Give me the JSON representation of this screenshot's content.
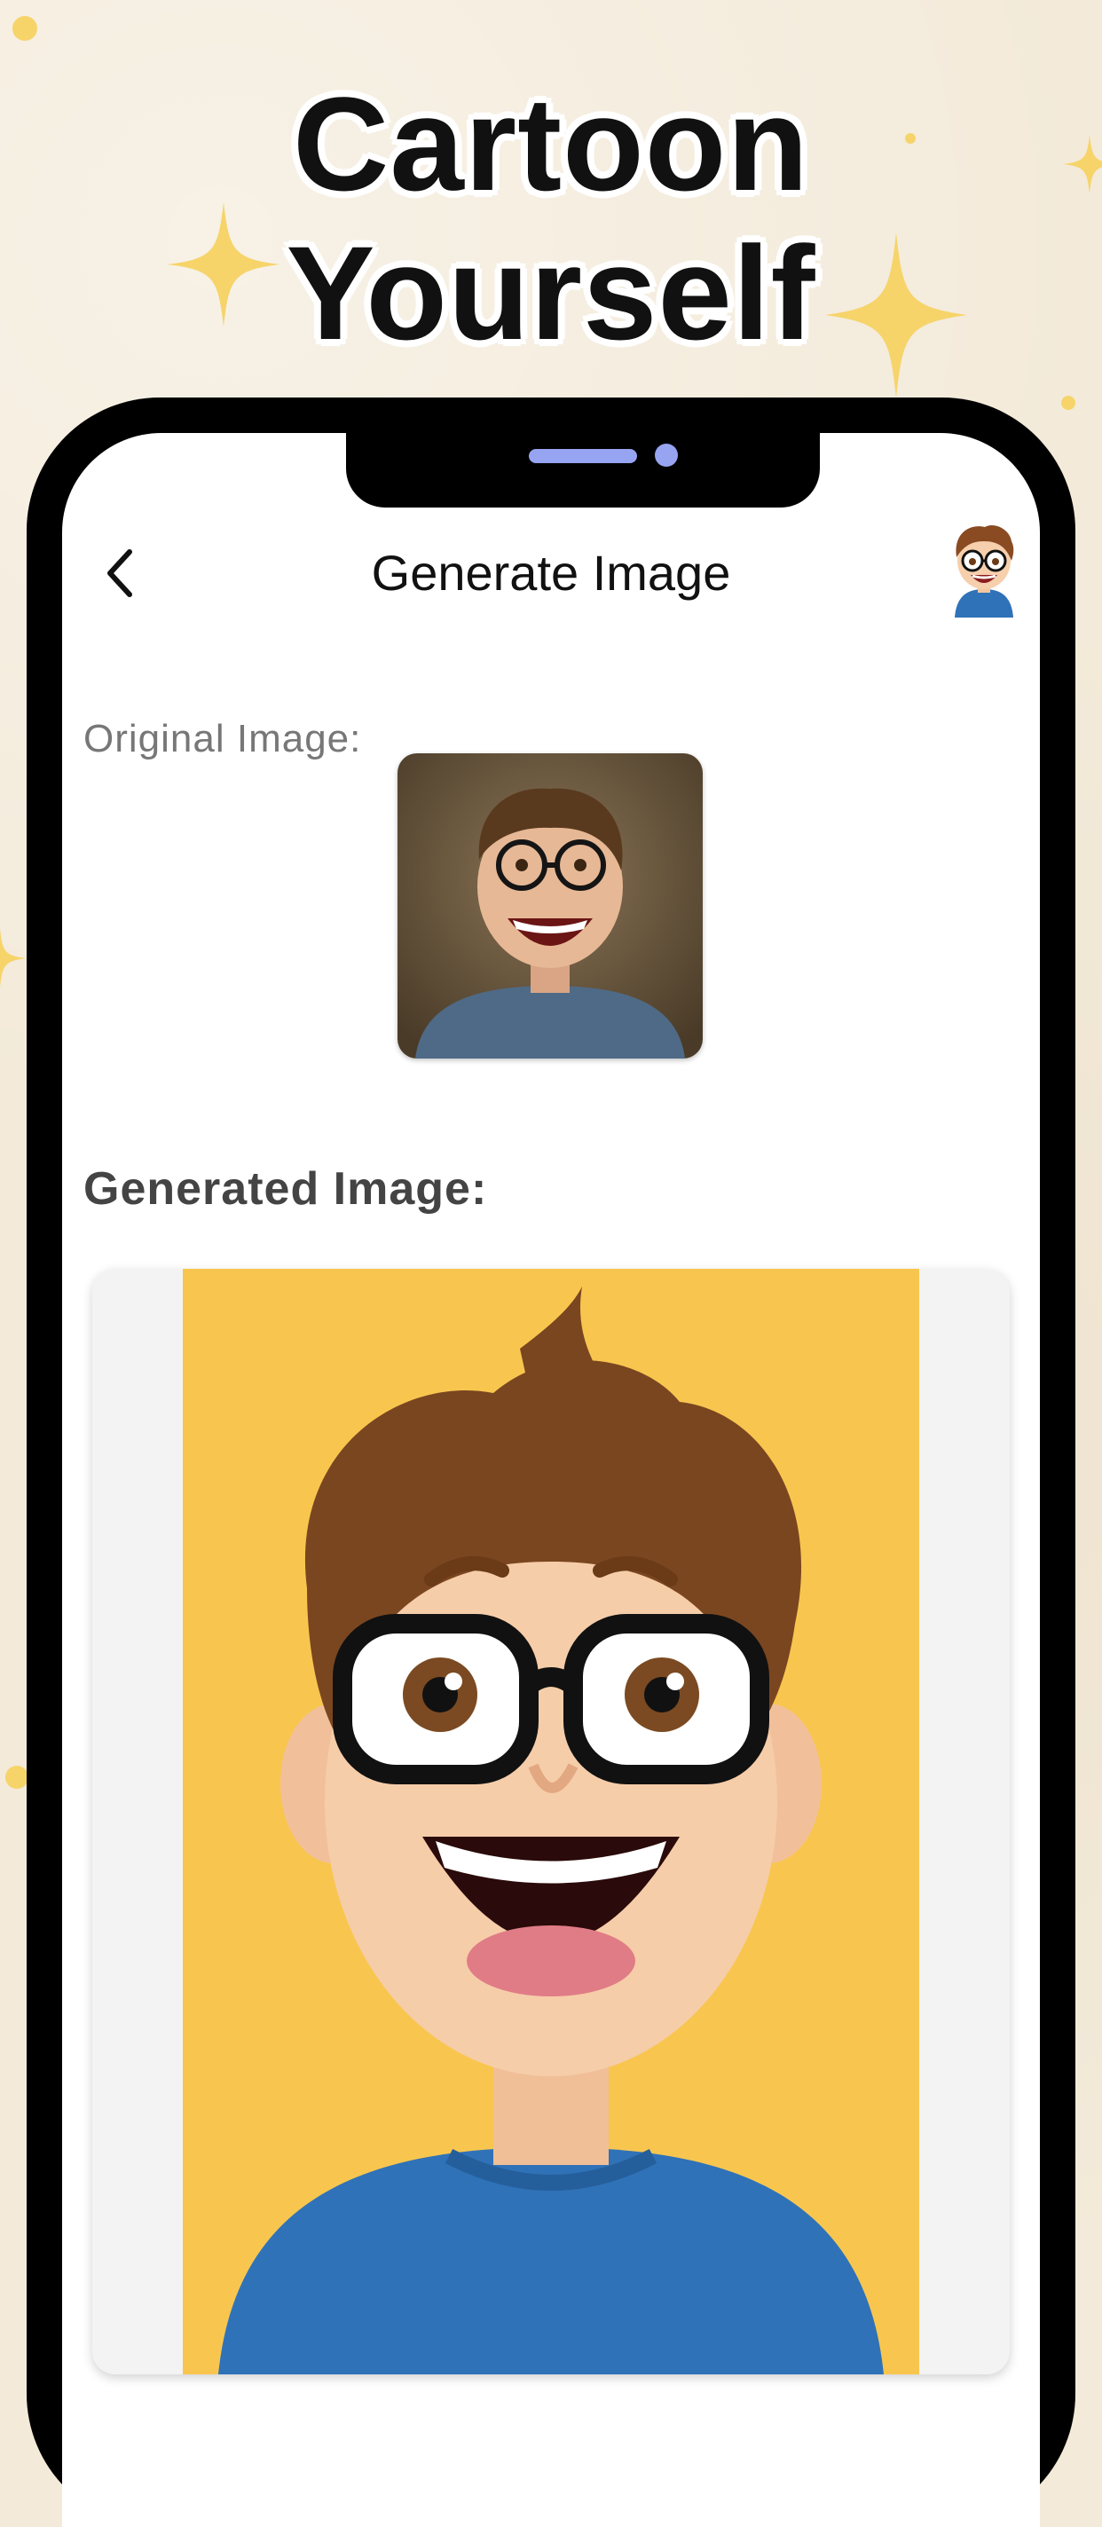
{
  "headline": {
    "line1": "Cartoon",
    "line2": "Yourself"
  },
  "nav": {
    "title": "Generate Image",
    "back_icon": "chevron-left-icon",
    "avatar_icon": "cartoon-avatar-icon"
  },
  "original": {
    "label": "Original Image:"
  },
  "generated": {
    "label": "Generated Image:"
  },
  "colors": {
    "background": "#f3ead9",
    "sparkle": "#f6d46a",
    "notch_accent": "#97a4f2",
    "generated_bg": "#f8c64f",
    "shirt": "#2f72b8"
  }
}
